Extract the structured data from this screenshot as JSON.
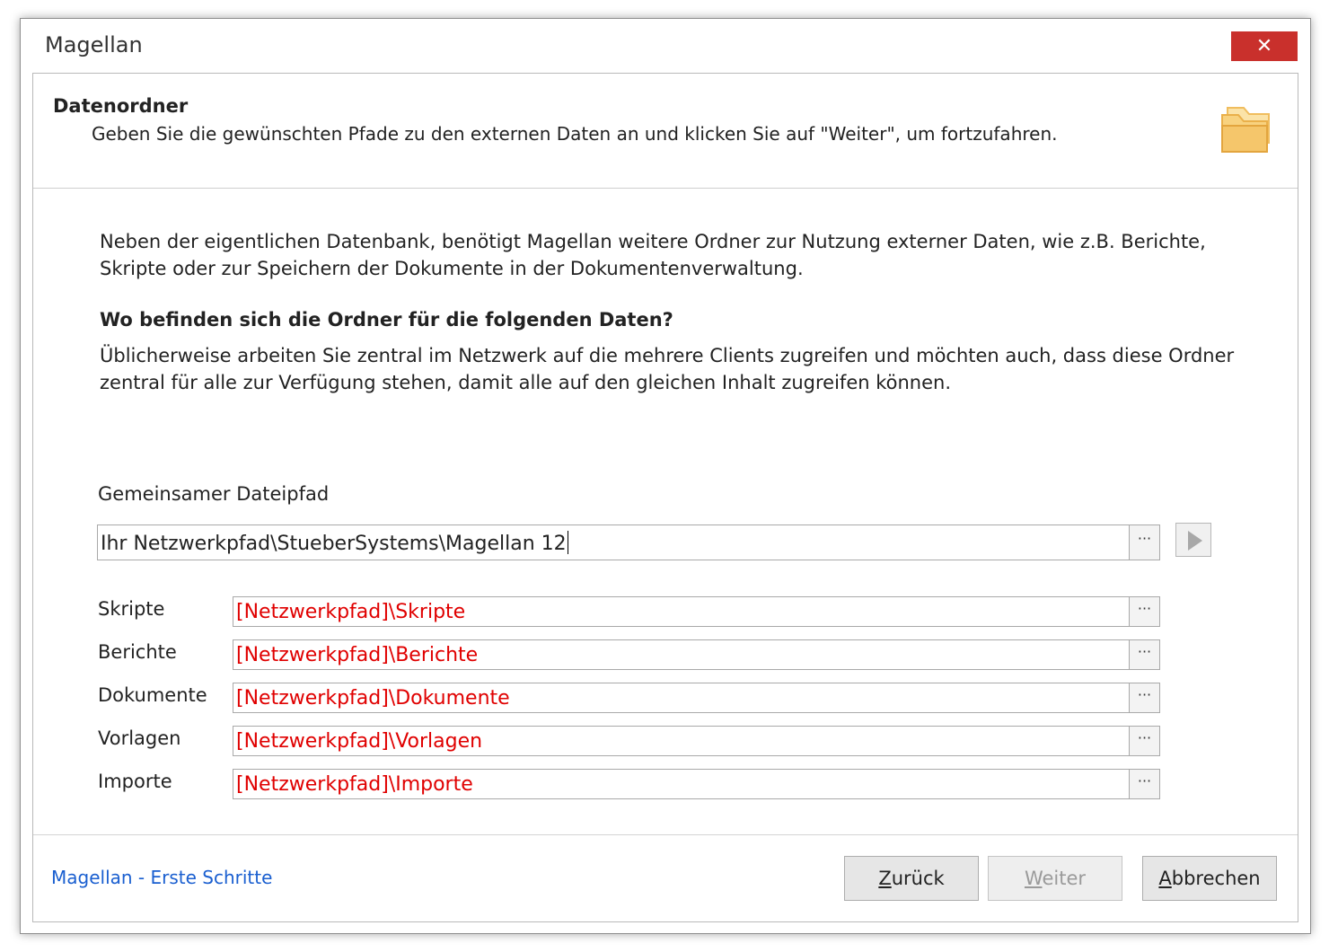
{
  "window": {
    "title": "Magellan",
    "close_symbol": "✕"
  },
  "header": {
    "title": "Datenordner",
    "subtitle": "Geben Sie die gewünschten Pfade zu den externen Daten an und klicken Sie auf \"Weiter\", um fortzufahren.",
    "icon": "folder-icon"
  },
  "body": {
    "intro": "Neben der eigentlichen Datenbank, benötigt Magellan weitere Ordner zur Nutzung externer Daten, wie z.B. Berichte, Skripte oder zur Speichern der Dokumente in der Dokumentenverwaltung.",
    "question": "Wo befinden sich die Ordner für die folgenden Daten?",
    "explain": "Üblicherweise arbeiten Sie zentral im Netzwerk auf die mehrere Clients zugreifen und möchten auch, dass diese Ordner zentral für alle zur Verfügung stehen, damit alle auf den gleichen Inhalt zugreifen können."
  },
  "shared_path": {
    "label": "Gemeinsamer Dateipfad",
    "value": "Ihr Netzwerkpfad\\StueberSystems\\Magellan 12",
    "browse_label": "···"
  },
  "paths": [
    {
      "label": "Skripte",
      "value": "[Netzwerkpfad]\\Skripte",
      "browse_label": "···"
    },
    {
      "label": "Berichte",
      "value": "[Netzwerkpfad]\\Berichte",
      "browse_label": "···"
    },
    {
      "label": "Dokumente",
      "value": "[Netzwerkpfad]\\Dokumente",
      "browse_label": "···"
    },
    {
      "label": "Vorlagen",
      "value": "[Netzwerkpfad]\\Vorlagen",
      "browse_label": "···"
    },
    {
      "label": "Importe",
      "value": "[Netzwerkpfad]\\Importe",
      "browse_label": "···"
    }
  ],
  "footer": {
    "help_link": "Magellan - Erste Schritte",
    "back_first": "Z",
    "back_rest": "urück",
    "next_first": "W",
    "next_rest": "eiter",
    "cancel_first": "A",
    "cancel_rest": "bbrechen"
  },
  "colors": {
    "path_text": "#e00000",
    "link": "#1a5fd0",
    "close": "#c9302c",
    "folder": "#f5c66b"
  }
}
